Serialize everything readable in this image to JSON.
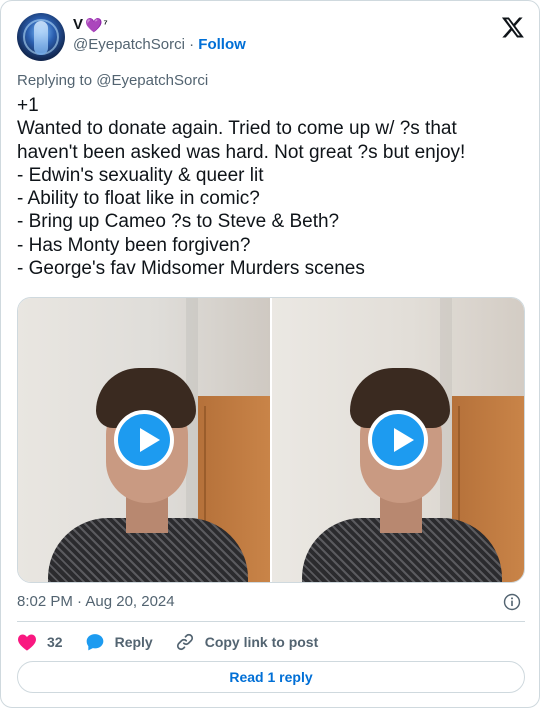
{
  "author": {
    "display_name": "V",
    "name_emoji": "💜",
    "name_superscript": "⁷",
    "handle": "@EyepatchSorci",
    "separator": "·",
    "follow_label": "Follow"
  },
  "reply_context": "Replying to @EyepatchSorci",
  "tweet_lines": [
    "+1",
    "Wanted to donate again. Tried to come up w/ ?s that",
    "haven't been asked was hard. Not great ?s but enjoy!",
    "- Edwin's sexuality & queer lit",
    "- Ability to float like in comic?",
    "- Bring up Cameo ?s to Steve & Beth?",
    "- Has Monty been forgiven?",
    "- George's fav Midsomer Murders scenes"
  ],
  "timestamp": "8:02 PM · Aug 20, 2024",
  "actions": {
    "like_count": "32",
    "reply_label": "Reply",
    "copy_label": "Copy link to post"
  },
  "read_reply_label": "Read 1 reply",
  "colors": {
    "accent": "#006fd6",
    "like": "#f91880",
    "play_button": "#1d9bf0",
    "muted_text": "#536471",
    "border": "#cfd9de"
  },
  "icons": [
    "x-logo-icon",
    "play-icon",
    "info-icon",
    "heart-icon",
    "reply-bubble-icon",
    "link-icon"
  ]
}
